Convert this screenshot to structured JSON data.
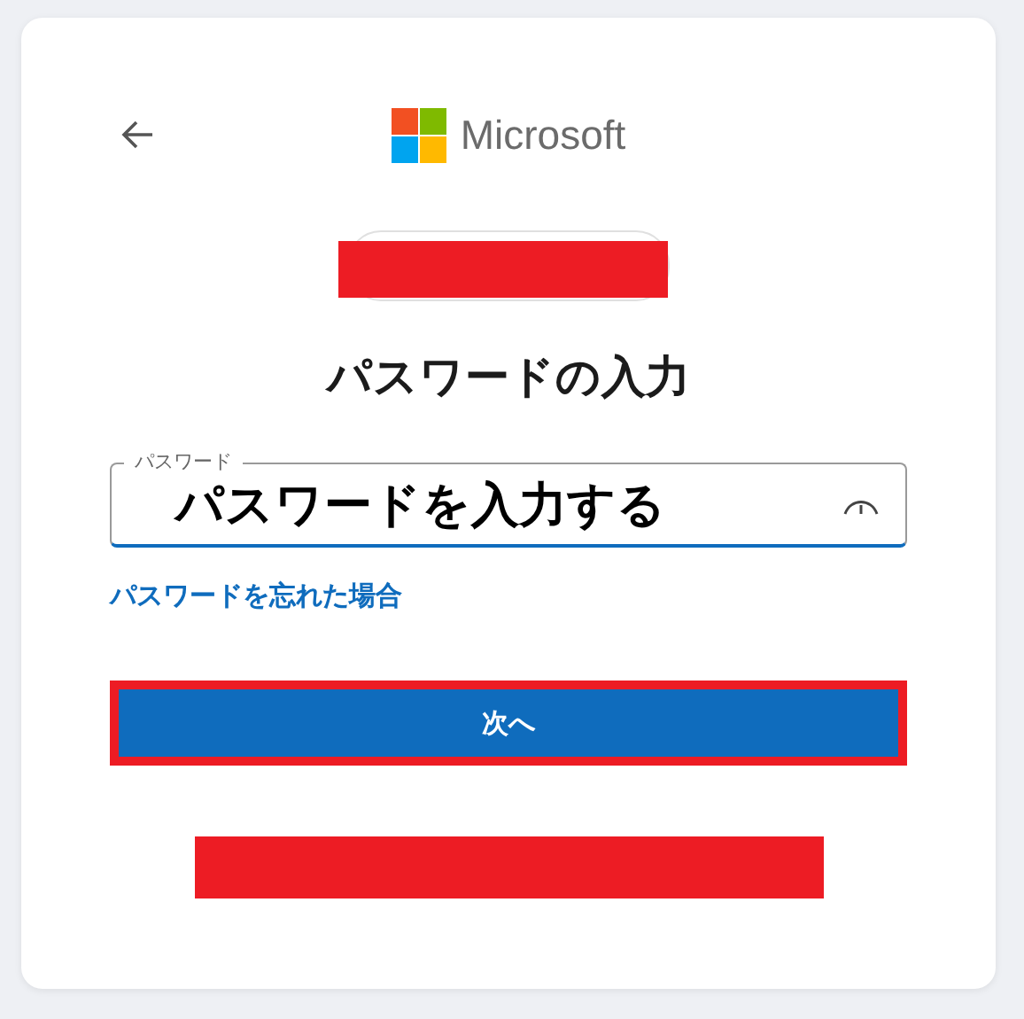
{
  "logo": {
    "text": "Microsoft"
  },
  "account": {
    "redacted": true
  },
  "title": "パスワードの入力",
  "password_field": {
    "label": "パスワード",
    "annotation": "パスワードを入力する"
  },
  "forgot_link": "パスワードを忘れた場合",
  "next_button": {
    "label": "次へ",
    "highlighted": true
  },
  "footer": {
    "redacted": true
  }
}
